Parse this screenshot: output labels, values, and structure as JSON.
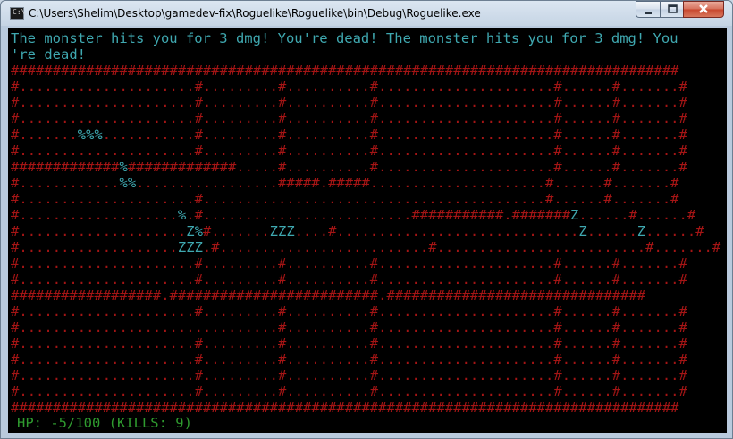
{
  "window": {
    "title": "C:\\Users\\Shelim\\Desktop\\gamedev-fix\\Roguelike\\Roguelike\\bin\\Debug\\Roguelike.exe",
    "icon": "console-app-icon",
    "controls": [
      "minimize-icon",
      "maximize-icon",
      "close-icon"
    ]
  },
  "console": {
    "message_line1": "The monster hits you for 3 dmg! You're dead! The monster hits you for 3 dmg! You",
    "message_line2": "'re dead!",
    "status": "HP: -5/100 (KILLS: 9)"
  },
  "map": {
    "legend": {
      "#": "wall",
      ".": "floor",
      "%": "corpse",
      "Z": "monster"
    },
    "rows": [
      "################################################################################",
      "#.....................#.........#..........#.....................#......#.......#",
      "#.....................#.........#..........#.....................#......#.......#",
      "#.....................#.........#..........#.....................#......#.......#",
      "#.......%%%...........#.........#..........#.....................#......#.......#",
      "#.....................#.........#..........#.....................#......#.......#",
      "#############%#############.....#..........#.....................#......#.......#",
      "#............%%.................#####.#####.....................#......#.......#",
      "#.....................#.........................................#......#.......#",
      "#...................%.#.........................###########.#######Z......#......#",
      "#....................Z%#.......ZZZ....#.............................Z......Z......#",
      "#...................ZZZ.#.........................#.........................#.......#",
      "#.....................#.........#..........#.....................#......#.......#",
      "#.....................#.........#..........#.....................#......#.......#",
      "##################.#########################.###############################",
      "#.....................#.........#..........#.....................#......#.......#",
      "#...............................#..........#.....................#......#.......#",
      "#.....................#.........#..........#.....................#......#.......#",
      "#.....................#.........#..........#.....................#......#.......#",
      "#.....................#.........#..........#.....................#......#.......#",
      "#.....................#.........#..........#.....................#......#.......#",
      "################################################################################"
    ]
  }
}
